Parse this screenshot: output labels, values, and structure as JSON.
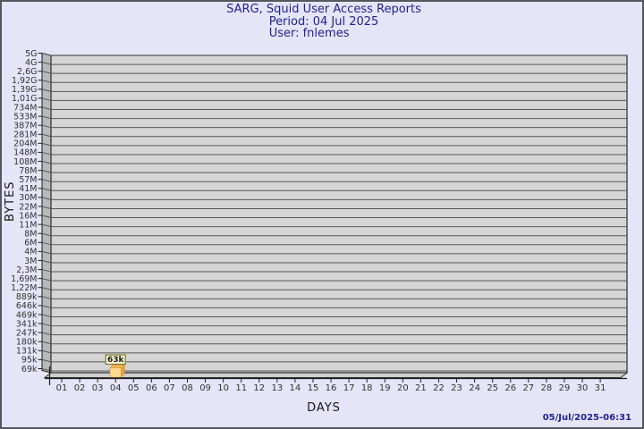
{
  "header": {
    "title": "SARG, Squid User Access Reports",
    "period": "Period: 04 Jul 2025",
    "user": "User: fnlemes"
  },
  "footer": {
    "timestamp": "05/Jul/2025-06:31"
  },
  "colors": {
    "page_background": "#e5e5f7",
    "page_border": "#56565e",
    "title_text": "#22228f",
    "plot_fill": "#d5d5d5",
    "wall_fill": "#b9b9b9",
    "floor_fill": "#cfcfcf",
    "grid_line": "#585858",
    "axis_line": "#1a1a1a",
    "tick_label": "#333333",
    "bar_front": "#ffd98e",
    "bar_top": "#f6b24e",
    "bar_side": "#e9a33c",
    "annotation_bg": "#fef7ce",
    "annotation_border": "#7a7a2e",
    "annotation_text": "#1a1a1a"
  },
  "chart_data": {
    "type": "bar",
    "title": "SARG, Squid User Access Reports",
    "subtitle": [
      "Period: 04 Jul 2025",
      "User: fnlemes"
    ],
    "xlabel": "DAYS",
    "ylabel": "BYTES",
    "scale": "logarithmic",
    "grid": true,
    "x_categories": [
      "01",
      "02",
      "03",
      "04",
      "05",
      "06",
      "07",
      "08",
      "09",
      "10",
      "11",
      "12",
      "13",
      "14",
      "15",
      "16",
      "17",
      "18",
      "19",
      "20",
      "21",
      "22",
      "23",
      "24",
      "25",
      "26",
      "27",
      "28",
      "29",
      "30",
      "31"
    ],
    "y_tick_labels_top_to_bottom": [
      "5G",
      "4G",
      "2,6G",
      "1,92G",
      "1,39G",
      "1,01G",
      "734M",
      "533M",
      "387M",
      "281M",
      "204M",
      "148M",
      "108M",
      "78M",
      "57M",
      "41M",
      "30M",
      "22M",
      "16M",
      "11M",
      "8M",
      "6M",
      "4M",
      "3M",
      "2,3M",
      "1,69M",
      "1,22M",
      "889k",
      "646k",
      "469k",
      "341k",
      "247k",
      "180k",
      "131k",
      "95k",
      "69k"
    ],
    "series": [
      {
        "name": "fnlemes",
        "unit": "bytes",
        "points": [
          {
            "x": "04",
            "label": "63k",
            "value": 63000
          }
        ]
      }
    ],
    "annotation": {
      "text": "63k",
      "x": "04"
    }
  }
}
